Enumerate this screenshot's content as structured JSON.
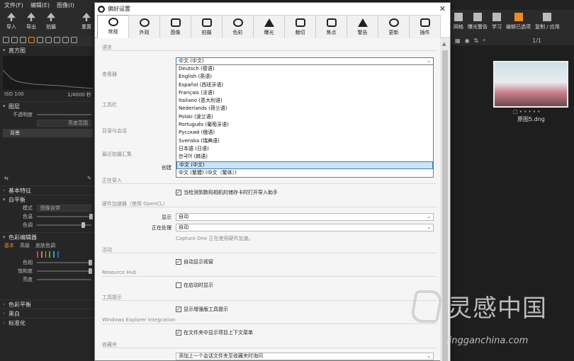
{
  "menubar": [
    "文件(F)",
    "编辑(E)",
    "图像(I)"
  ],
  "toolbar": [
    {
      "label": "导入",
      "icon": "import-icon"
    },
    {
      "label": "导出",
      "icon": "export-icon"
    },
    {
      "label": "拍摄",
      "icon": "camera-icon"
    },
    {
      "label": "重置",
      "icon": "reset-icon"
    }
  ],
  "rightbar": [
    {
      "label": "网格",
      "icon": "grid-icon"
    },
    {
      "label": "曝光警告",
      "icon": "warning-icon"
    },
    {
      "label": "学习",
      "icon": "learn-icon"
    },
    {
      "label": "编辑已选项",
      "icon": "edit-selected-icon"
    },
    {
      "label": "复制 / 应用",
      "icon": "copy-apply-icon"
    }
  ],
  "left": {
    "histogram_title": "直方图",
    "iso": "ISO 100",
    "shutter": "1/4000 秒",
    "layers_title": "图层",
    "opacity_label": "不透明度",
    "brightness_field": "亮度范围",
    "layer_background": "背景",
    "basic_title": "基本特征",
    "wb_title": "白平衡",
    "mode_label": "模式",
    "mode_value": "图像自带",
    "temp_label": "色温",
    "tint_label": "色调",
    "color_editor_title": "色彩编辑器",
    "ce_tabs": [
      "基本",
      "高级",
      "皮肤色调"
    ],
    "hue_label": "色相",
    "sat_label": "饱和度",
    "light_label": "亮度",
    "color_balance_title": "色彩平衡",
    "bw_title": "黑白",
    "normalize_title": "标准化",
    "swatches": [
      "#d43d3d",
      "#e07b2e",
      "#d8b42a",
      "#4caf3c",
      "#2da6b8",
      "#2d63c9"
    ]
  },
  "browser": {
    "page": "1/1",
    "filename": "原图5.dng",
    "dots": "□ • • • • •"
  },
  "dialog": {
    "title": "偏好设置",
    "tabs": [
      {
        "label": "常规",
        "icon": "general-icon"
      },
      {
        "label": "外观",
        "icon": "eye-icon"
      },
      {
        "label": "图像",
        "icon": "image-icon"
      },
      {
        "label": "拍摄",
        "icon": "camera-icon"
      },
      {
        "label": "色彩",
        "icon": "color-icon"
      },
      {
        "label": "曝光",
        "icon": "exposure-icon"
      },
      {
        "label": "裁切",
        "icon": "crop-icon"
      },
      {
        "label": "焦点",
        "icon": "focus-icon"
      },
      {
        "label": "警告",
        "icon": "warning-icon"
      },
      {
        "label": "更新",
        "icon": "update-icon"
      },
      {
        "label": "插件",
        "icon": "plugin-icon"
      }
    ],
    "groups": {
      "language": "语言",
      "viewer": "查看器",
      "toolbar": "工具栏",
      "catalog": "目录与会话",
      "recent": "最近拍摄汇集",
      "importing": "正在导入",
      "hw": "硬件加速器（使用 OpenCL）",
      "activity": "活动",
      "resource_hub": "Resource Hub",
      "tooltips": "工具提示",
      "explorer": "Windows Explorer Integration",
      "favorites": "收藏夹"
    },
    "language_value": "中文 (中文)",
    "languages": [
      "Deutsch (德语)",
      "English (英语)",
      "Español (西班牙语)",
      "Français (法语)",
      "Italiano (意大利语)",
      "Nederlands (荷兰语)",
      "Polski (波兰语)",
      "Português (葡萄牙语)",
      "Русский (俄语)",
      "Svenska (瑞典语)",
      "日本語 (日语)",
      "한국어 (韩语)",
      "中文 (中文)",
      "中文 (繁體) (中文（繁体）)"
    ],
    "create_label": "创建",
    "import_check": "当检测到数码相机的储存卡时打开导入助手",
    "display_label": "显示",
    "display_value": "自动",
    "processing_label": "正在处理",
    "processing_value": "自动",
    "hw_note": "Capture One 正在使用硬件加速。",
    "activity_check": "自动显示视窗",
    "hub_check": "在启动时显示",
    "tooltip_check": "显示增强版工具提示",
    "explorer_check": "在文件夹中显示项目上下文菜单",
    "favorites_value": "添加上一个会话文件夹至收藏夹时询问"
  },
  "watermark": {
    "cn": "灵感中国",
    "en": "lingganchina.com"
  }
}
